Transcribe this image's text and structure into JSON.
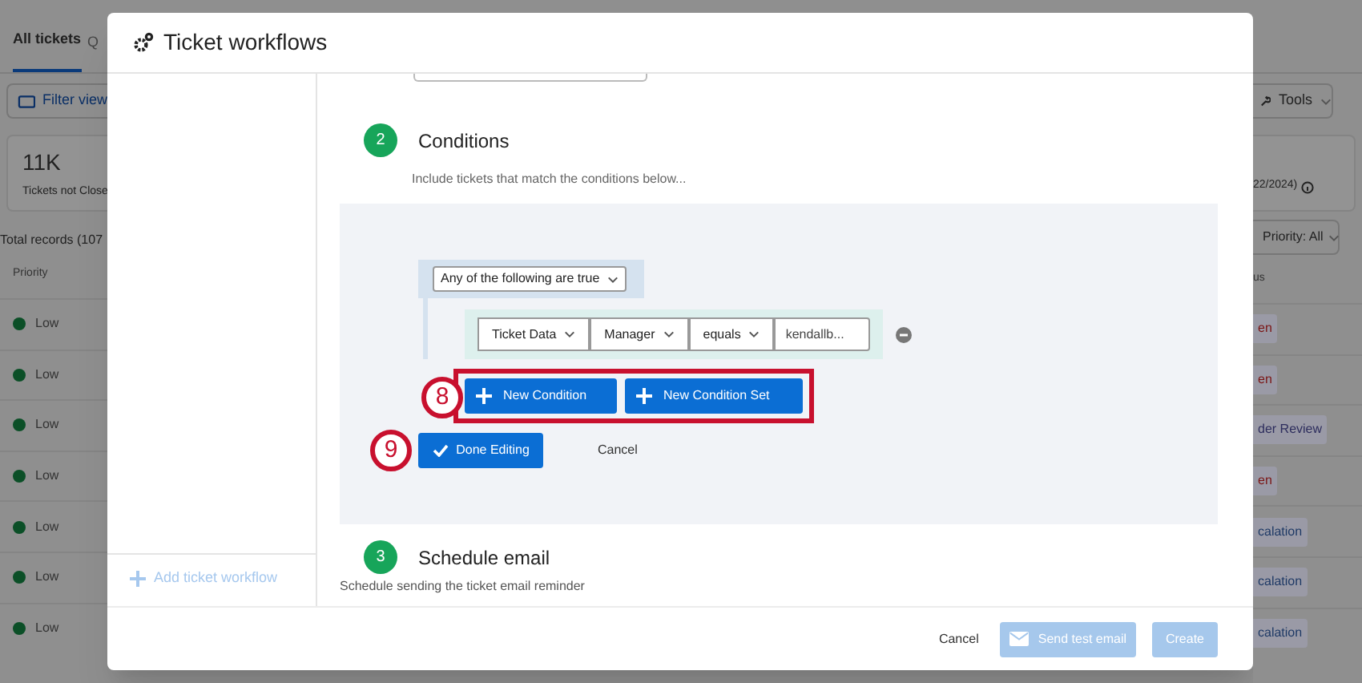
{
  "background": {
    "tabs": [
      {
        "label": "All tickets",
        "selected": true
      },
      {
        "label": "Q",
        "selected": false
      }
    ],
    "filter_button": "Filter view",
    "stat": {
      "value": "11K",
      "label": "Tickets not Close"
    },
    "total_records": "Total records (107",
    "priority_header": "Priority",
    "rows": [
      {
        "priority": "Low",
        "color": "#0b4f27"
      },
      {
        "priority": "Low",
        "color": "#0b4f27"
      },
      {
        "priority": "Low",
        "color": "#0b4f27"
      },
      {
        "priority": "Low",
        "color": "#0b4f27"
      },
      {
        "priority": "Low",
        "color": "#0b4f27"
      },
      {
        "priority": "Low",
        "color": "#0b4f27"
      },
      {
        "priority": "Low",
        "color": "#0b4f27"
      }
    ],
    "tools_button": "Tools",
    "stat_note": "22/2024)",
    "priority_filter": "Priority: All",
    "status_header": "us",
    "statuses": [
      {
        "label": "en",
        "color": "#7a1414"
      },
      {
        "label": "en",
        "color": "#7a1414"
      },
      {
        "label": "der Review",
        "color": "#2e2e5e"
      },
      {
        "label": "en",
        "color": "#7a1414"
      },
      {
        "label": "calation",
        "color": "#1f3a66"
      },
      {
        "label": "calation",
        "color": "#1f3a66"
      },
      {
        "label": "calation",
        "color": "#1f3a66"
      }
    ]
  },
  "modal": {
    "title": "Ticket workflows",
    "sidebar": {
      "add_button": "Add ticket workflow"
    },
    "conditions_step": {
      "number": "2",
      "title": "Conditions",
      "description": "Include tickets that match the conditions below...",
      "conjunction": "Any of the following are true",
      "condition": {
        "fields": [
          "Ticket Data",
          "Manager",
          "equals"
        ],
        "value": "kendallb..."
      },
      "new_condition": "New Condition",
      "new_condition_set": "New Condition Set",
      "done": "Done Editing",
      "cancel": "Cancel",
      "callouts": [
        "8",
        "9"
      ]
    },
    "schedule_step": {
      "number": "3",
      "title": "Schedule email",
      "description": "Schedule sending the ticket email reminder"
    },
    "footer": {
      "cancel": "Cancel",
      "send_test": {
        "label": "Send test email",
        "disabled": true
      },
      "create": {
        "label": "Create",
        "disabled": true
      }
    }
  }
}
